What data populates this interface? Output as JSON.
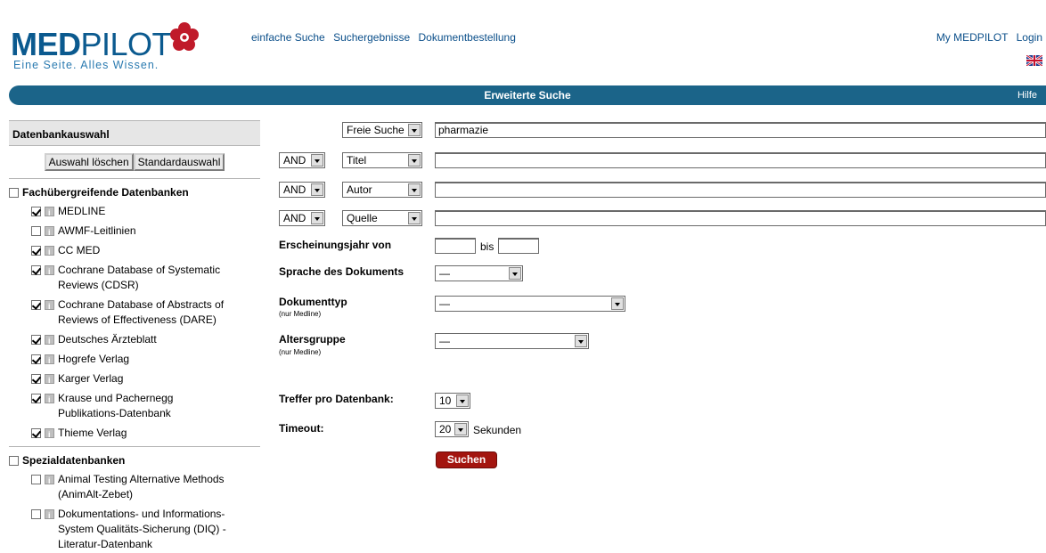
{
  "logo": {
    "brand_part1": "MED",
    "brand_part2": "PILOT",
    "tagline": "Eine Seite. Alles Wissen.",
    "icon": "flower-logo-icon",
    "brand_color": "#0b5a8f"
  },
  "topnav": [
    "einfache Suche",
    "Suchergebnisse",
    "Dokumentbestellung"
  ],
  "toplinks": {
    "my": "My MEDPILOT",
    "login": "Login",
    "language_icon": "uk-flag-icon"
  },
  "titlebar": {
    "title": "Erweiterte Suche",
    "help": "Hilfe",
    "color": "#1b6489"
  },
  "sidebar": {
    "heading": "Datenbankauswahl",
    "buttons": {
      "clear": "Auswahl löschen",
      "default": "Standardauswahl"
    },
    "groups": [
      {
        "name": "Fachübergreifende Datenbanken",
        "checked": false,
        "items": [
          {
            "label": "MEDLINE",
            "checked": true
          },
          {
            "label": "AWMF-Leitlinien",
            "checked": false
          },
          {
            "label": "CC MED",
            "checked": true
          },
          {
            "label": "Cochrane Database of Systematic Reviews (CDSR)",
            "checked": true
          },
          {
            "label": "Cochrane Database of Abstracts of Reviews of Effectiveness (DARE)",
            "checked": true
          },
          {
            "label": "Deutsches Ärzteblatt",
            "checked": true
          },
          {
            "label": "Hogrefe Verlag",
            "checked": true
          },
          {
            "label": "Karger Verlag",
            "checked": true
          },
          {
            "label": "Krause und Pachernegg Publikations-Datenbank",
            "checked": true
          },
          {
            "label": "Thieme Verlag",
            "checked": true
          }
        ]
      },
      {
        "name": "Spezialdatenbanken",
        "checked": false,
        "items": [
          {
            "label": "Animal Testing Alternative Methods (AnimAlt-Zebet)",
            "checked": false
          },
          {
            "label": "Dokumentations- und Informations-System Qualitäts-Sicherung (DIQ) - Literatur-Datenbank",
            "checked": false
          }
        ]
      }
    ]
  },
  "search": {
    "rows": [
      {
        "operator": "",
        "field": "Freie Suche",
        "value": "pharmazie"
      },
      {
        "operator": "AND",
        "field": "Titel",
        "value": ""
      },
      {
        "operator": "AND",
        "field": "Autor",
        "value": ""
      },
      {
        "operator": "AND",
        "field": "Quelle",
        "value": ""
      }
    ],
    "year_label": "Erscheinungsjahr von",
    "year_from": "",
    "year_bis": "bis",
    "year_to": "",
    "language_label": "Sprache des Dokuments",
    "language_value": "—",
    "doctype_label": "Dokumenttyp",
    "doctype_note": "(nur Medline)",
    "doctype_value": "—",
    "age_label": "Altersgruppe",
    "age_note": "(nur Medline)",
    "age_value": "—",
    "hits_label": "Treffer pro Datenbank:",
    "hits_value": "10",
    "timeout_label": "Timeout:",
    "timeout_value": "20",
    "timeout_unit": "Sekunden",
    "submit": "Suchen",
    "submit_color": "#a3150f"
  }
}
